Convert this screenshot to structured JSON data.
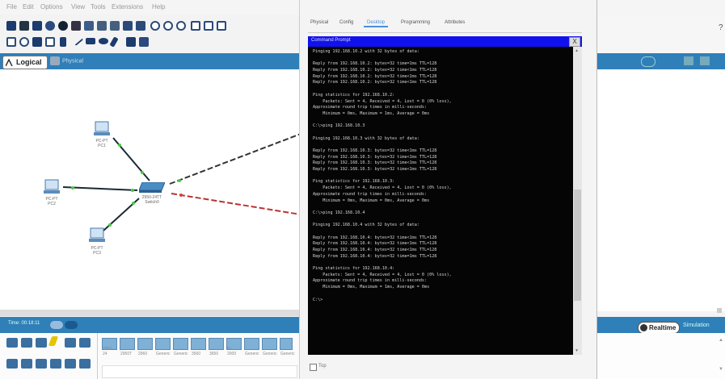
{
  "menubar": {
    "items": [
      "File",
      "Edit",
      "Options",
      "View",
      "Tools",
      "Extensions",
      "Help"
    ]
  },
  "workspace": {
    "logical_label": "Logical",
    "physical_label": "Physical"
  },
  "devices": [
    {
      "label1": "PC-PT",
      "label2": "PC1"
    },
    {
      "label1": "PC-PT",
      "label2": "PC2"
    },
    {
      "label1": "PC-PT",
      "label2": "PC3"
    },
    {
      "label1": "2950-24TT",
      "label2": "Switch0"
    }
  ],
  "device_window": {
    "tabs": [
      "Physical",
      "Config",
      "Desktop",
      "Programming",
      "Attributes"
    ],
    "active_tab_index": 2,
    "cmd_title": "Command Prompt",
    "close_label": "X",
    "top_label": "Top",
    "terminal_lines": [
      "Pinging 192.168.10.2 with 32 bytes of data:",
      "",
      "Reply from 192.168.10.2: bytes=32 time=1ms TTL=128",
      "Reply from 192.168.10.2: bytes=32 time<1ms TTL=128",
      "Reply from 192.168.10.2: bytes=32 time<1ms TTL=128",
      "Reply from 192.168.10.2: bytes=32 time<1ms TTL=128",
      "",
      "Ping statistics for 192.168.10.2:",
      "    Packets: Sent = 4, Received = 4, Lost = 0 (0% loss),",
      "Approximate round trip times in milli-seconds:",
      "    Minimum = 0ms, Maximum = 1ms, Average = 0ms",
      "",
      "C:\\>ping 192.168.10.3",
      "",
      "Pinging 192.168.10.3 with 32 bytes of data:",
      "",
      "Reply from 192.168.10.3: bytes=32 time<1ms TTL=128",
      "Reply from 192.168.10.3: bytes=32 time<1ms TTL=128",
      "Reply from 192.168.10.3: bytes=32 time<1ms TTL=128",
      "Reply from 192.168.10.3: bytes=32 time<1ms TTL=128",
      "",
      "Ping statistics for 192.168.10.3:",
      "    Packets: Sent = 4, Received = 4, Lost = 0 (0% loss),",
      "Approximate round trip times in milli-seconds:",
      "    Minimum = 0ms, Maximum = 0ms, Average = 0ms",
      "",
      "C:\\>ping 192.168.10.4",
      "",
      "Pinging 192.168.10.4 with 32 bytes of data:",
      "",
      "Reply from 192.168.10.4: bytes=32 time<1ms TTL=128",
      "Reply from 192.168.10.4: bytes=32 time<1ms TTL=128",
      "Reply from 192.168.10.4: bytes=32 time<1ms TTL=128",
      "Reply from 192.168.10.4: bytes=32 time=1ms TTL=128",
      "",
      "Ping statistics for 192.168.10.4:",
      "    Packets: Sent = 4, Received = 4, Lost = 0 (0% loss),",
      "Approximate round trip times in milli-seconds:",
      "    Minimum = 0ms, Maximum = 1ms, Average = 0ms",
      "",
      "C:\\>"
    ]
  },
  "statusbar": {
    "time": "Time: 00:18:11",
    "realtime_label": "Realtime",
    "simulation_label": "Simulation"
  },
  "palette_labels": [
    "2950-24",
    "2950T",
    "2960",
    "Generic",
    "Generic",
    "3560",
    "3650",
    "IE-2000",
    "Generic",
    "Generic",
    "Generic"
  ],
  "colors": {
    "accent": "#2f7fb9",
    "cmd_title_bg": "#1111ee",
    "terminal_bg": "#050505"
  }
}
